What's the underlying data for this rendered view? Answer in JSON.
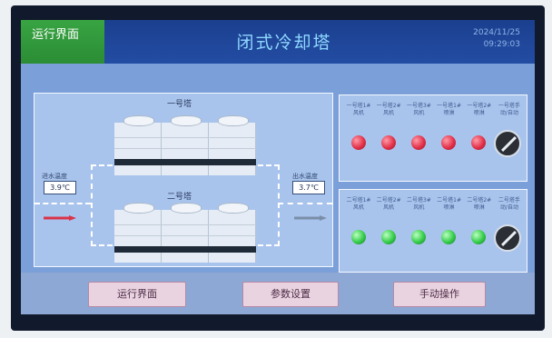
{
  "header": {
    "mode_label": "运行界面",
    "title": "闭式冷却塔",
    "date": "2024/11/25",
    "time": "09:29:03"
  },
  "towers": {
    "tower1_label": "一号塔",
    "tower2_label": "二号塔"
  },
  "inlet": {
    "label": "进水温度",
    "value": "3.9℃"
  },
  "outlet": {
    "label": "出水温度",
    "value": "3.7℃"
  },
  "status_panel_1": {
    "labels": [
      "一号塔1#风机",
      "一号塔2#风机",
      "一号塔3#风机",
      "一号塔1#喷淋",
      "一号塔2#喷淋",
      "一号塔手动/自动"
    ],
    "lamp_color": "red"
  },
  "status_panel_2": {
    "labels": [
      "二号塔1#风机",
      "二号塔2#风机",
      "二号塔3#风机",
      "二号塔1#喷淋",
      "二号塔2#喷淋",
      "二号塔手动/自动"
    ],
    "lamp_color": "green"
  },
  "nav": {
    "run": "运行界面",
    "params": "参数设置",
    "manual": "手动操作"
  },
  "colors": {
    "header_bg": "#1b3f8f",
    "mode_bg": "#38a442",
    "title_fg": "#8fd8ff",
    "content_bg": "#7b9fd9",
    "panel_bg": "#a9c4ec",
    "lamp_red": "#e2314a",
    "lamp_green": "#36cc4a",
    "inlet_arrow": "#d9344a",
    "outlet_arrow": "#7a8ea8",
    "button_bg": "#ead3e0"
  }
}
